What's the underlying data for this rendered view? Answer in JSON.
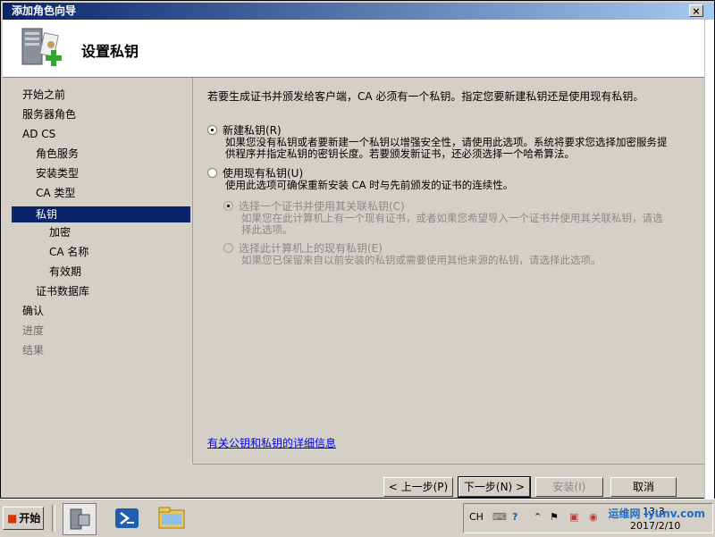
{
  "window": {
    "title": "添加角色向导",
    "close_label": "×"
  },
  "header": {
    "title": "设置私钥",
    "icon": "server-add-icon"
  },
  "nav": {
    "items": [
      {
        "label": "开始之前",
        "level": 0,
        "state": "normal"
      },
      {
        "label": "服务器角色",
        "level": 0,
        "state": "normal"
      },
      {
        "label": "AD CS",
        "level": 0,
        "state": "normal"
      },
      {
        "label": "角色服务",
        "level": 1,
        "state": "normal"
      },
      {
        "label": "安装类型",
        "level": 1,
        "state": "normal"
      },
      {
        "label": "CA 类型",
        "level": 1,
        "state": "normal"
      },
      {
        "label": "私钥",
        "level": 1,
        "state": "selected"
      },
      {
        "label": "加密",
        "level": 2,
        "state": "normal"
      },
      {
        "label": "CA 名称",
        "level": 2,
        "state": "normal"
      },
      {
        "label": "有效期",
        "level": 2,
        "state": "normal"
      },
      {
        "label": "证书数据库",
        "level": 1,
        "state": "normal"
      },
      {
        "label": "确认",
        "level": 0,
        "state": "normal"
      },
      {
        "label": "进度",
        "level": 0,
        "state": "dim"
      },
      {
        "label": "结果",
        "level": 0,
        "state": "dim"
      }
    ]
  },
  "content": {
    "intro": "若要生成证书并颁发给客户端，CA 必须有一个私钥。指定您要新建私钥还是使用现有私钥。",
    "option_new": {
      "label": "新建私钥(R)",
      "desc_line1": "如果您没有私钥或者要新建一个私钥以增强安全性，请使用此选项。系统将要求您选择加密服务提",
      "desc_line2": "供程序并指定私钥的密钥长度。若要颁发新证书，还必须选择一个哈希算法。",
      "checked": true
    },
    "option_existing": {
      "label": "使用现有私钥(U)",
      "desc": "使用此选项可确保重新安装 CA 时与先前颁发的证书的连续性。",
      "checked": false
    },
    "sub_option_cert": {
      "label": "选择一个证书并使用其关联私钥(C)",
      "desc_line1": "如果您在此计算机上有一个现有证书，或者如果您希望导入一个证书并使用其关联私钥，请选",
      "desc_line2": "择此选项。",
      "checked": true,
      "enabled": false
    },
    "sub_option_key": {
      "label": "选择此计算机上的现有私钥(E)",
      "desc": "如果您已保留来自以前安装的私钥或需要使用其他来源的私钥，请选择此选项。",
      "checked": false,
      "enabled": false
    },
    "link": "有关公钥和私钥的详细信息"
  },
  "buttons": {
    "prev": "< 上一步(P)",
    "next": "下一步(N) >",
    "install": "安装(I)",
    "cancel": "取消"
  },
  "taskbar": {
    "start_label": "开始",
    "lang": "CH",
    "time": "13:3",
    "date": "2017/2/10",
    "watermark": "运维网 iyunv.com",
    "icons": [
      "server-manager-icon",
      "powershell-icon",
      "folder-icon"
    ]
  },
  "colors": {
    "title_bar_start": "#0a246a",
    "title_bar_end": "#a6caf0",
    "selection": "#0a246a",
    "link": "#0000ee",
    "desktop": "#3a6ea5"
  }
}
